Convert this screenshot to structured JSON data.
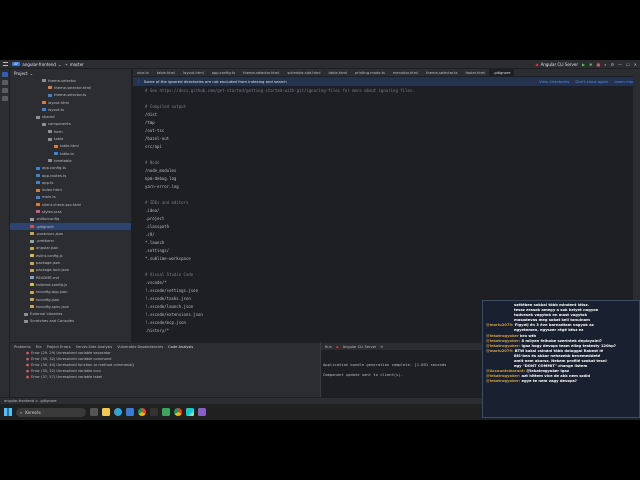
{
  "titlebar": {
    "project": "angular-frontend",
    "branch": "master",
    "run_config": "Angular CLI Server"
  },
  "project_panel": {
    "title": "Project",
    "rows": [
      {
        "label": "theme-selector",
        "indent": 2,
        "icon": "folder"
      },
      {
        "label": "theme-selector.html",
        "indent": 3,
        "icon": "html"
      },
      {
        "label": "theme-selector.ts",
        "indent": 3,
        "icon": "ts"
      },
      {
        "label": "layout.html",
        "indent": 2,
        "icon": "html"
      },
      {
        "label": "layout.ts",
        "indent": 2,
        "icon": "ts"
      },
      {
        "label": "shared",
        "indent": 1,
        "icon": "folder"
      },
      {
        "label": "components",
        "indent": 2,
        "icon": "folder"
      },
      {
        "label": "form",
        "indent": 3,
        "icon": "folder"
      },
      {
        "label": "table",
        "indent": 3,
        "icon": "folder"
      },
      {
        "label": "table.html",
        "indent": 4,
        "icon": "html"
      },
      {
        "label": "table.ts",
        "indent": 4,
        "icon": "ts"
      },
      {
        "label": "timetable",
        "indent": 3,
        "icon": "folder"
      },
      {
        "label": "app.config.ts",
        "indent": 1,
        "icon": "ts"
      },
      {
        "label": "app.routes.ts",
        "indent": 1,
        "icon": "ts"
      },
      {
        "label": "app.ts",
        "indent": 1,
        "icon": "ts"
      },
      {
        "label": "index.html",
        "indent": 1,
        "icon": "html"
      },
      {
        "label": "main.ts",
        "indent": 1,
        "icon": "ts"
      },
      {
        "label": "silent-check-sso.html",
        "indent": 1,
        "icon": "html"
      },
      {
        "label": "styles.scss",
        "indent": 1,
        "icon": "scss"
      },
      {
        "label": ".editorconfig",
        "indent": 0,
        "icon": "cfg"
      },
      {
        "label": ".gitignore",
        "indent": 0,
        "icon": "git",
        "selected": true
      },
      {
        "label": ".postcssrc.json",
        "indent": 0,
        "icon": "json"
      },
      {
        "label": ".prettierrc",
        "indent": 0,
        "icon": "cfg"
      },
      {
        "label": "angular.json",
        "indent": 0,
        "icon": "json"
      },
      {
        "label": "eslint.config.js",
        "indent": 0,
        "icon": "js"
      },
      {
        "label": "package.json",
        "indent": 0,
        "icon": "json"
      },
      {
        "label": "package-lock.json",
        "indent": 0,
        "icon": "json"
      },
      {
        "label": "README.md",
        "indent": 0,
        "icon": "md"
      },
      {
        "label": "tailwind.config.js",
        "indent": 0,
        "icon": "js"
      },
      {
        "label": "tsconfig.app.json",
        "indent": 0,
        "icon": "json"
      },
      {
        "label": "tsconfig.json",
        "indent": 0,
        "icon": "json"
      },
      {
        "label": "tsconfig.spec.json",
        "indent": 0,
        "icon": "json"
      },
      {
        "label": "External Libraries",
        "indent": -1,
        "icon": "lib"
      },
      {
        "label": "Scratches and Consoles",
        "indent": -1,
        "icon": "lib"
      }
    ]
  },
  "tabs": [
    "vice.ts",
    "table.html",
    "layout.html",
    "app.config.ts",
    "theme-selector.html",
    "schedule-slot.html",
    "table.html",
    "printing-mode.ts",
    "menubar.html",
    "theme-selector.ts",
    "footer.html",
    ".gitignore"
  ],
  "active_tab": ".gitignore",
  "banner": {
    "text": "Some of the ignored directories are not excluded from indexing and search",
    "actions": [
      "View directories",
      "Don't show again",
      "Learn more"
    ]
  },
  "code_lines": [
    {
      "t": "# See https://docs.github.com/get-started/getting-started-with-git/ignoring-files for more about ignoring files.",
      "c": true
    },
    {
      "t": "",
      "c": false
    },
    {
      "t": "# Compiled output",
      "c": true
    },
    {
      "t": "/dist",
      "c": false
    },
    {
      "t": "/tmp",
      "c": false
    },
    {
      "t": "/out-tsc",
      "c": false
    },
    {
      "t": "/bazel-out",
      "c": false
    },
    {
      "t": "src/api",
      "c": false
    },
    {
      "t": "",
      "c": false
    },
    {
      "t": "# Node",
      "c": true
    },
    {
      "t": "/node_modules",
      "c": false
    },
    {
      "t": "npm-debug.log",
      "c": false
    },
    {
      "t": "yarn-error.log",
      "c": false
    },
    {
      "t": "",
      "c": false
    },
    {
      "t": "# IDEs and editors",
      "c": true
    },
    {
      "t": ".idea/",
      "c": false
    },
    {
      "t": ".project",
      "c": false
    },
    {
      "t": ".classpath",
      "c": false
    },
    {
      "t": ".c9/",
      "c": false
    },
    {
      "t": "*.launch",
      "c": false
    },
    {
      "t": ".settings/",
      "c": false
    },
    {
      "t": "*.sublime-workspace",
      "c": false
    },
    {
      "t": "",
      "c": false
    },
    {
      "t": "# Visual Studio Code",
      "c": true
    },
    {
      "t": ".vscode/*",
      "c": false
    },
    {
      "t": "!.vscode/settings.json",
      "c": false
    },
    {
      "t": "!.vscode/tasks.json",
      "c": false
    },
    {
      "t": "!.vscode/launch.json",
      "c": false
    },
    {
      "t": "!.vscode/extensions.json",
      "c": false
    },
    {
      "t": "!.vscode/mcp.json",
      "c": false
    },
    {
      "t": ".history/*",
      "c": false
    }
  ],
  "problems": {
    "tabs": [
      "Problems",
      "File",
      "Project Errors",
      "Server-Side Analysis",
      "Vulnerable Dependencies",
      "Code Analysis"
    ],
    "items": [
      "Error (29, 29) Unresolved variable separator",
      "Error (30, 32) Unresolved variable command",
      "Error (30, 44) Unresolved function or method command()",
      "Error (35, 32) Unresolved variable icon",
      "Error (37, 57) Unresolved variable label"
    ]
  },
  "run": {
    "title": "Run",
    "config": "Angular CLI Server",
    "lines": [
      "Application bundle generation complete. [1.891 seconds",
      "Component update sent to client(s)."
    ]
  },
  "status": {
    "path": "angular-frontend > .gitignore"
  },
  "taskbar": {
    "search": "Keresés"
  },
  "chat": [
    {
      "u": "",
      "m": "szélében sokkal több mindent látsz."
    },
    {
      "u": "",
      "m": "tessz erasok amegy a sok helyet nagyon"
    },
    {
      "u": "",
      "m": "tudvesek vagytok en most vagytok"
    },
    {
      "u": "",
      "m": "masodevas meg sokat kell tanulnom"
    },
    {
      "u": "@mariu2079:",
      "m": "Figyelj én 3 éve barnadtam vagyok az"
    },
    {
      "u": "",
      "m": "egyetemen, egyszer régé kész ez"
    },
    {
      "u": "@lekatrogyoker",
      "m": "bro wth"
    },
    {
      "u": "@lekatrogyoker:",
      "m": "8 milyen felhobe szerintek deployolni?"
    },
    {
      "u": "@lekatrogyoker:",
      "m": "Igaz hogy devops team elleg testesty 120hp?"
    },
    {
      "u": "@mariu2079:",
      "m": "BTW kaksi csináni több dologgal Rabest lé"
    },
    {
      "u": "",
      "m": "BIS-ben és akkor nehezebb bevemeddeté"
    },
    {
      "u": "",
      "m": "amit nem akarsz. Nekem profilé szokat tesni"
    },
    {
      "u": "",
      "m": "egy \"DONT COMMIT\" change listem"
    },
    {
      "u": "@Accountclearant:",
      "m": "@lekatrogyoker Igaz"
    },
    {
      "u": "@lekatrogyoker:",
      "m": "azt hittem vice de akk nem szóld"
    },
    {
      "u": "@lekatrogyoker:",
      "m": "egye te nem vagy devops?"
    }
  ]
}
